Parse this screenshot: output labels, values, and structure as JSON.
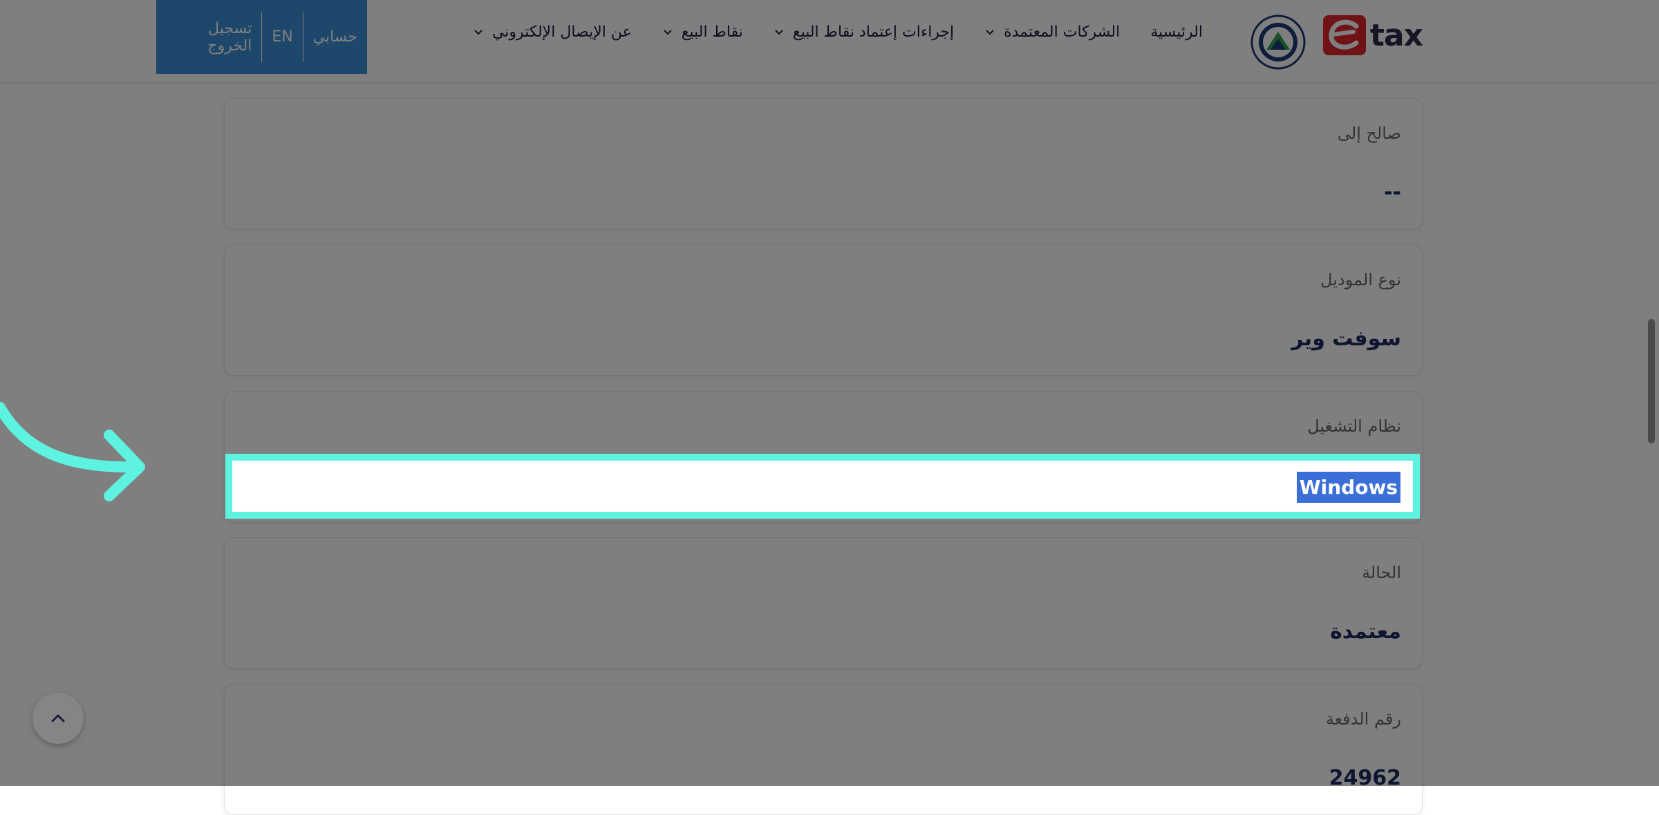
{
  "header": {
    "logo_text": "tax",
    "nav": [
      {
        "label": "الرئيسية",
        "has_dropdown": false
      },
      {
        "label": "الشركات المعتمدة",
        "has_dropdown": true
      },
      {
        "label": "إجراءات إعتماد نقاط البيع",
        "has_dropdown": true
      },
      {
        "label": "نقاط البيع",
        "has_dropdown": true
      },
      {
        "label": "عن الإيصال الإلكتروني",
        "has_dropdown": true
      }
    ],
    "user_menu": {
      "account": "حسابي",
      "lang": "EN",
      "logout": "تسجيل الخروج"
    }
  },
  "cards": [
    {
      "label": "صالح إلى",
      "value": "--"
    },
    {
      "label": "نوع الموديل",
      "value": "سوفت وير"
    },
    {
      "label": "نظام التشغيل",
      "value": "Windows"
    },
    {
      "label": "الحالة",
      "value": "معتمدة"
    },
    {
      "label": "رقم الدفعة",
      "value": "24962"
    }
  ],
  "colors": {
    "highlight_border": "#5ef2e1",
    "selection": "#3a6fd8",
    "user_box": "#3d8fd9",
    "value_text": "#1a2a60"
  },
  "icons": {
    "back_to_top": "chevron-up-icon",
    "nav_dropdown": "chevron-down-icon",
    "annotation": "curved-arrow-icon"
  }
}
